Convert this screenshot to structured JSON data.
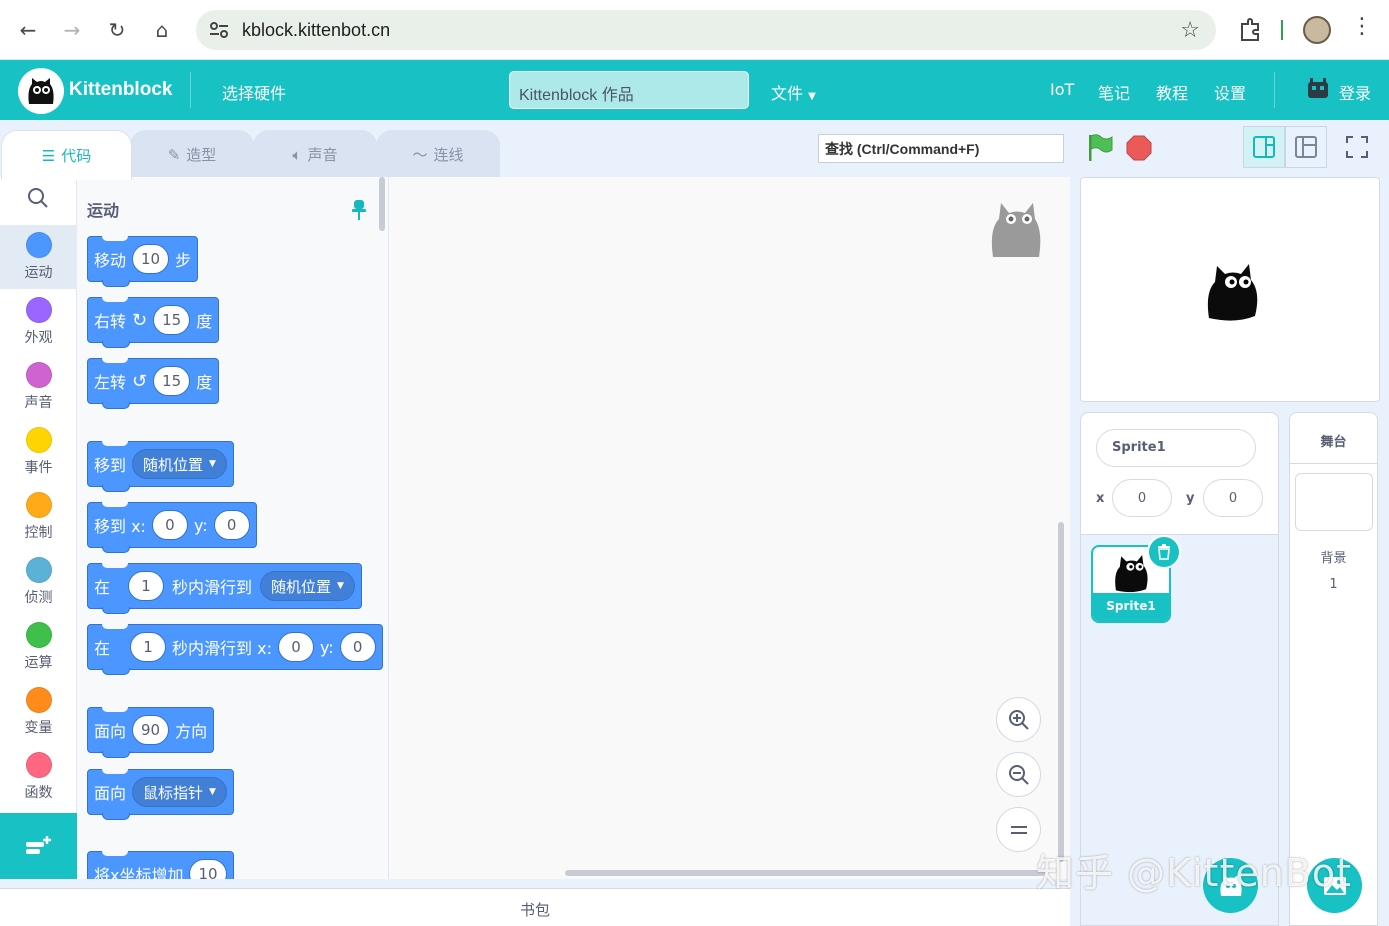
{
  "browser": {
    "url": "kblock.kittenbot.cn"
  },
  "header": {
    "logo_text": "Kittenblock",
    "select_hardware": "选择硬件",
    "project_title": "Kittenblock 作品",
    "file_menu": "文件",
    "menu_items": [
      "IoT",
      "笔记",
      "教程",
      "设置"
    ],
    "login": "登录"
  },
  "tabs": [
    {
      "label": "代码",
      "icon": "code-icon"
    },
    {
      "label": "造型",
      "icon": "brush-icon"
    },
    {
      "label": "声音",
      "icon": "speaker-icon"
    },
    {
      "label": "连线",
      "icon": "wire-icon"
    }
  ],
  "search": {
    "placeholder": "查找 (Ctrl/Command+F)"
  },
  "categories": [
    {
      "label": "运动",
      "color": "#4c97ff"
    },
    {
      "label": "外观",
      "color": "#9966ff"
    },
    {
      "label": "声音",
      "color": "#cf63cf"
    },
    {
      "label": "事件",
      "color": "#ffd500"
    },
    {
      "label": "控制",
      "color": "#ffab19"
    },
    {
      "label": "侦测",
      "color": "#5cb1d6"
    },
    {
      "label": "运算",
      "color": "#40bf4a"
    },
    {
      "label": "变量",
      "color": "#ff8c1a"
    },
    {
      "label": "函数",
      "color": "#ff6680"
    }
  ],
  "palette": {
    "title": "运动",
    "blocks": {
      "move": {
        "label": "移动",
        "value": "10",
        "suffix": "步"
      },
      "turn_right": {
        "label": "右转",
        "value": "15",
        "suffix": "度"
      },
      "turn_left": {
        "label": "左转",
        "value": "15",
        "suffix": "度"
      },
      "goto": {
        "label": "移到",
        "option": "随机位置"
      },
      "goto_xy": {
        "label": "移到 x:",
        "x": "0",
        "ylabel": "y:",
        "y": "0"
      },
      "glide": {
        "label": "在",
        "secs": "1",
        "mid": "秒内滑行到",
        "option": "随机位置"
      },
      "glide_xy": {
        "label": "在",
        "secs": "1",
        "mid": "秒内滑行到 x:",
        "x": "0",
        "ylabel": "y:",
        "y": "0"
      },
      "point_dir": {
        "label": "面向",
        "value": "90",
        "suffix": "方向"
      },
      "point_towards": {
        "label": "面向",
        "option": "鼠标指针"
      },
      "change_x": {
        "label": "将x坐标增加",
        "value": "10"
      }
    }
  },
  "backpack": {
    "label": "书包"
  },
  "sprite": {
    "name": "Sprite1",
    "x_label": "x",
    "x": "0",
    "y_label": "y",
    "y": "0",
    "thumb_label": "Sprite1"
  },
  "stage_pane": {
    "title": "舞台",
    "backdrop_label": "背景",
    "backdrop_count": "1"
  },
  "watermark": "知乎 @KittenBot",
  "colors": {
    "accent": "#17c1c4",
    "motion": "#4c97ff"
  }
}
